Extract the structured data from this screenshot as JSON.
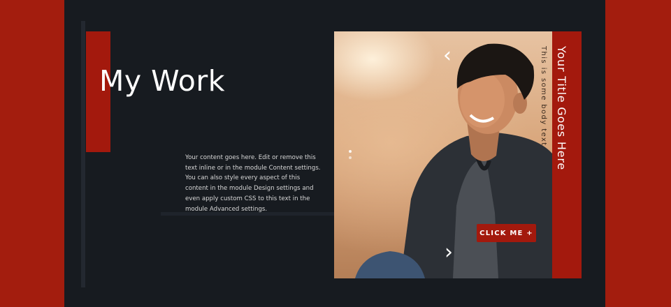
{
  "hero": {
    "heading": "My Work",
    "body": "Your content goes here. Edit or remove this text inline or in the module Content settings. You can also style every aspect of this content in the module Design settings and even apply custom CSS to this text in the module Advanced settings."
  },
  "slider": {
    "title": "Your Title Goes Here",
    "body": "This is some body text",
    "button_label": "CLICK ME +",
    "prev_arrow": "‹",
    "next_arrow": "›",
    "dot_count": 2
  },
  "colors": {
    "brand_red": "#a3190d",
    "panel_bg": "#171b20",
    "outer_bg": "#a31d0e",
    "text_primary": "#ffffff",
    "text_muted": "#d9d9d9"
  },
  "icons": {
    "prev": "chevron-left-icon",
    "next": "chevron-right-icon"
  }
}
